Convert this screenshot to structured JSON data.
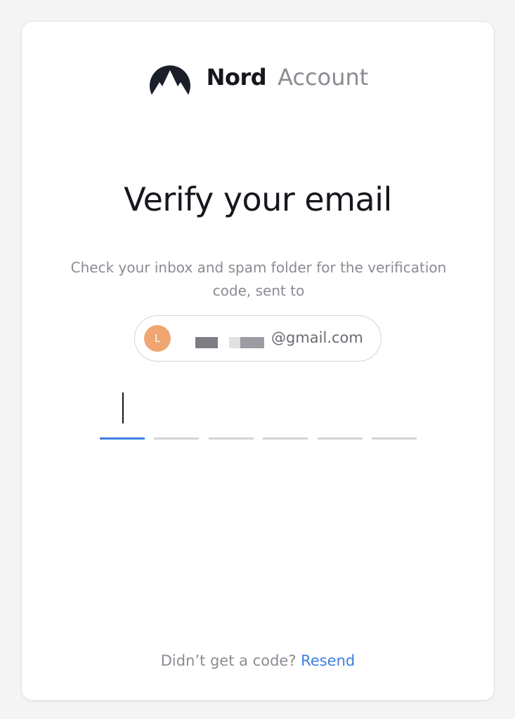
{
  "brand": {
    "logo_icon": "nord-mountain-icon",
    "name": "Nord",
    "product": "Account"
  },
  "title": "Verify your email",
  "subtitle": "Check your inbox and spam folder for the verification code, sent to",
  "email": {
    "avatar_letter": "L",
    "avatar_color": "#f0a572",
    "domain": "@gmail.com"
  },
  "code": {
    "slots": 6,
    "active_slot": 1,
    "accent_color": "#3e7ee1"
  },
  "footer": {
    "prompt": "Didn’t get a code?",
    "resend_label": "Resend"
  }
}
